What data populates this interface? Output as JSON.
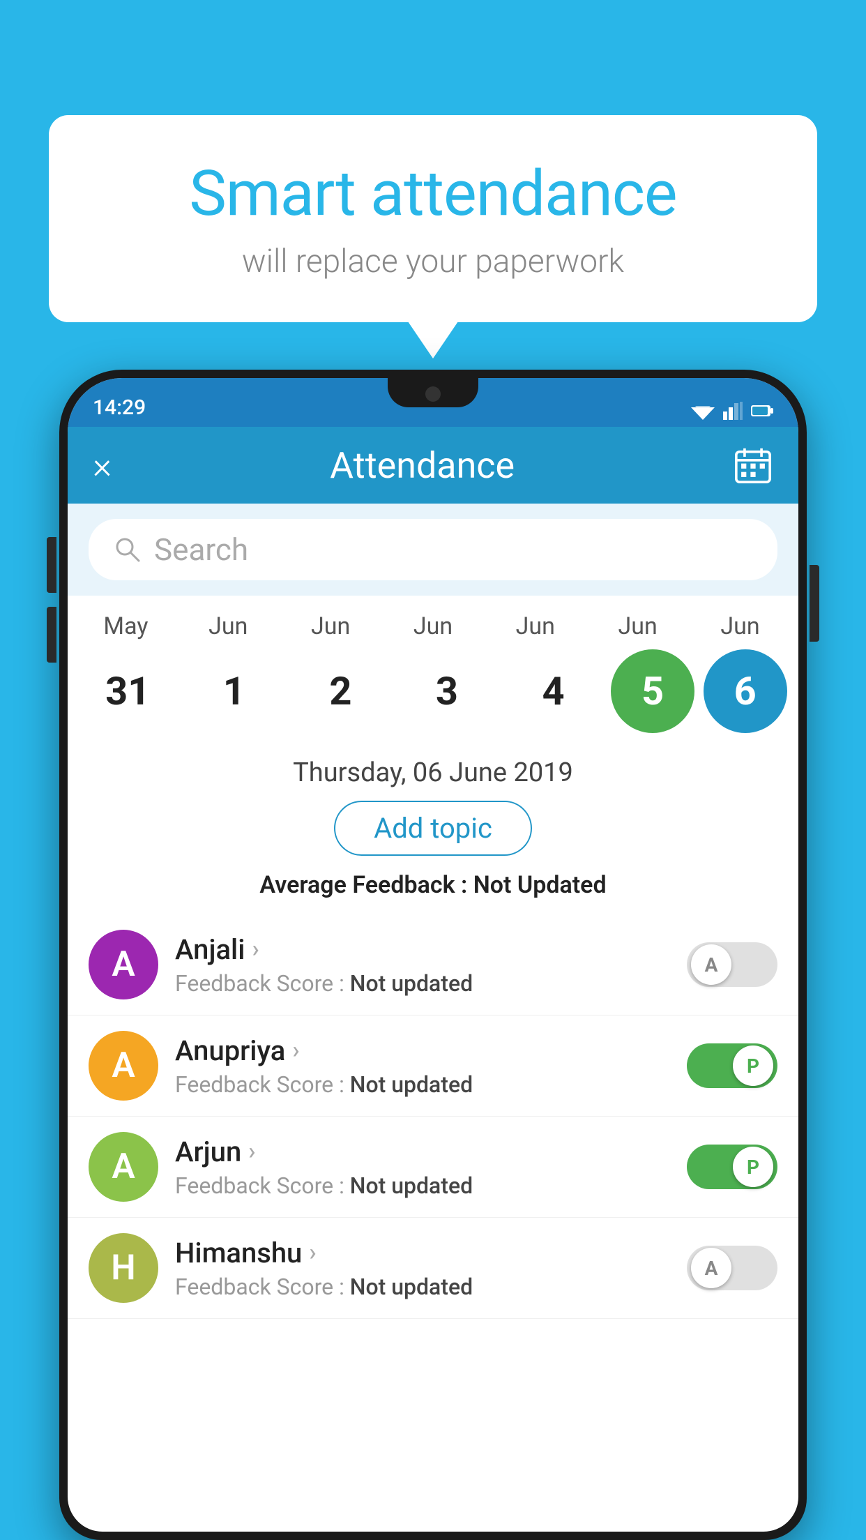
{
  "background_color": "#29b6e8",
  "bubble": {
    "title": "Smart attendance",
    "subtitle": "will replace your paperwork"
  },
  "status_bar": {
    "time": "14:29"
  },
  "header": {
    "title": "Attendance",
    "close_label": "×",
    "calendar_icon": "calendar-icon"
  },
  "search": {
    "placeholder": "Search"
  },
  "calendar": {
    "columns": [
      {
        "month": "May",
        "day": "31",
        "style": "normal"
      },
      {
        "month": "Jun",
        "day": "1",
        "style": "normal"
      },
      {
        "month": "Jun",
        "day": "2",
        "style": "normal"
      },
      {
        "month": "Jun",
        "day": "3",
        "style": "normal"
      },
      {
        "month": "Jun",
        "day": "4",
        "style": "normal"
      },
      {
        "month": "Jun",
        "day": "5",
        "style": "green"
      },
      {
        "month": "Jun",
        "day": "6",
        "style": "blue"
      }
    ]
  },
  "date_info": {
    "date_label": "Thursday, 06 June 2019",
    "add_topic_label": "Add topic",
    "avg_feedback_label": "Average Feedback :",
    "avg_feedback_value": "Not Updated"
  },
  "students": [
    {
      "name": "Anjali",
      "avatar_letter": "A",
      "avatar_color": "#9c27b0",
      "feedback_label": "Feedback Score :",
      "feedback_value": "Not updated",
      "toggle_state": "off",
      "toggle_letter": "A"
    },
    {
      "name": "Anupriya",
      "avatar_letter": "A",
      "avatar_color": "#f5a623",
      "feedback_label": "Feedback Score :",
      "feedback_value": "Not updated",
      "toggle_state": "on",
      "toggle_letter": "P"
    },
    {
      "name": "Arjun",
      "avatar_letter": "A",
      "avatar_color": "#8bc34a",
      "feedback_label": "Feedback Score :",
      "feedback_value": "Not updated",
      "toggle_state": "on",
      "toggle_letter": "P"
    },
    {
      "name": "Himanshu",
      "avatar_letter": "H",
      "avatar_color": "#aab84a",
      "feedback_label": "Feedback Score :",
      "feedback_value": "Not updated",
      "toggle_state": "off",
      "toggle_letter": "A"
    }
  ]
}
